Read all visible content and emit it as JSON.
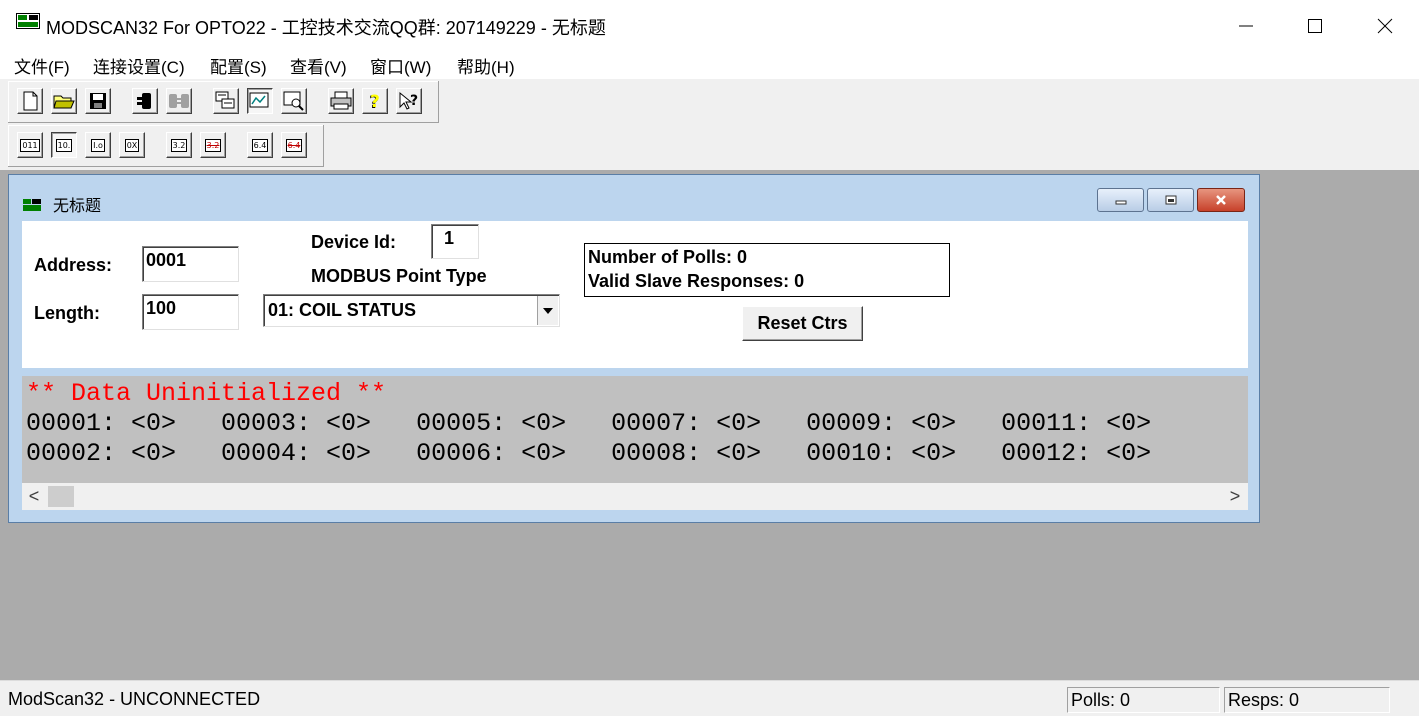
{
  "window": {
    "title": "MODSCAN32 For OPTO22 - 工控技术交流QQ群: 207149229 - 无标题",
    "minimize_icon": "minimize-icon",
    "maximize_icon": "maximize-icon",
    "close_icon": "close-icon"
  },
  "menu": [
    "文件(F)",
    "连接设置(C)",
    "配置(S)",
    "查看(V)",
    "窗口(W)",
    "帮助(H)"
  ],
  "toolbar1": [
    "new-file-icon",
    "open-folder-icon",
    "save-icon",
    "connect-icon",
    "disconnect-icon",
    "display-options-icon",
    "show-traffic-icon",
    "data-definition-icon",
    "print-icon",
    "help-icon",
    "context-help-icon"
  ],
  "toolbar2": {
    "labels": [
      "011",
      "10.",
      "I.o",
      "0X",
      "3.2",
      "3.2",
      "6.4",
      "6.4"
    ],
    "icons": [
      "binary-format-icon",
      "decimal-format-icon",
      "integer-format-icon",
      "hex-format-icon",
      "float-format-icon",
      "float-swapped-icon",
      "double-format-icon",
      "double-swapped-icon"
    ]
  },
  "child": {
    "title": "无标题",
    "address_label": "Address:",
    "address_value": "0001",
    "length_label": "Length:",
    "length_value": "100",
    "device_id_label": "Device Id:",
    "device_id_value": "1",
    "point_type_label": "MODBUS Point Type",
    "point_type_value": "01: COIL STATUS",
    "polls_text": "Number of Polls: 0",
    "valid_text": "Valid Slave Responses: 0",
    "reset_label": "Reset Ctrs",
    "data_header": "** Data Uninitialized **",
    "data_row1": "00001: <0>   00003: <0>   00005: <0>   00007: <0>   00009: <0>   00011: <0>",
    "data_row2": "00002: <0>   00004: <0>   00006: <0>   00008: <0>   00010: <0>   00012: <0>",
    "scroll_left": "<",
    "scroll_right": ">"
  },
  "status": {
    "connection": "ModScan32 - UNCONNECTED",
    "polls": "Polls: 0",
    "resps": "Resps: 0"
  },
  "colors": {
    "data_header": "#ff0000",
    "data_bg": "#c0c0c0",
    "mdi_bg": "#ababab",
    "child_frame": "#bcd5ee"
  }
}
